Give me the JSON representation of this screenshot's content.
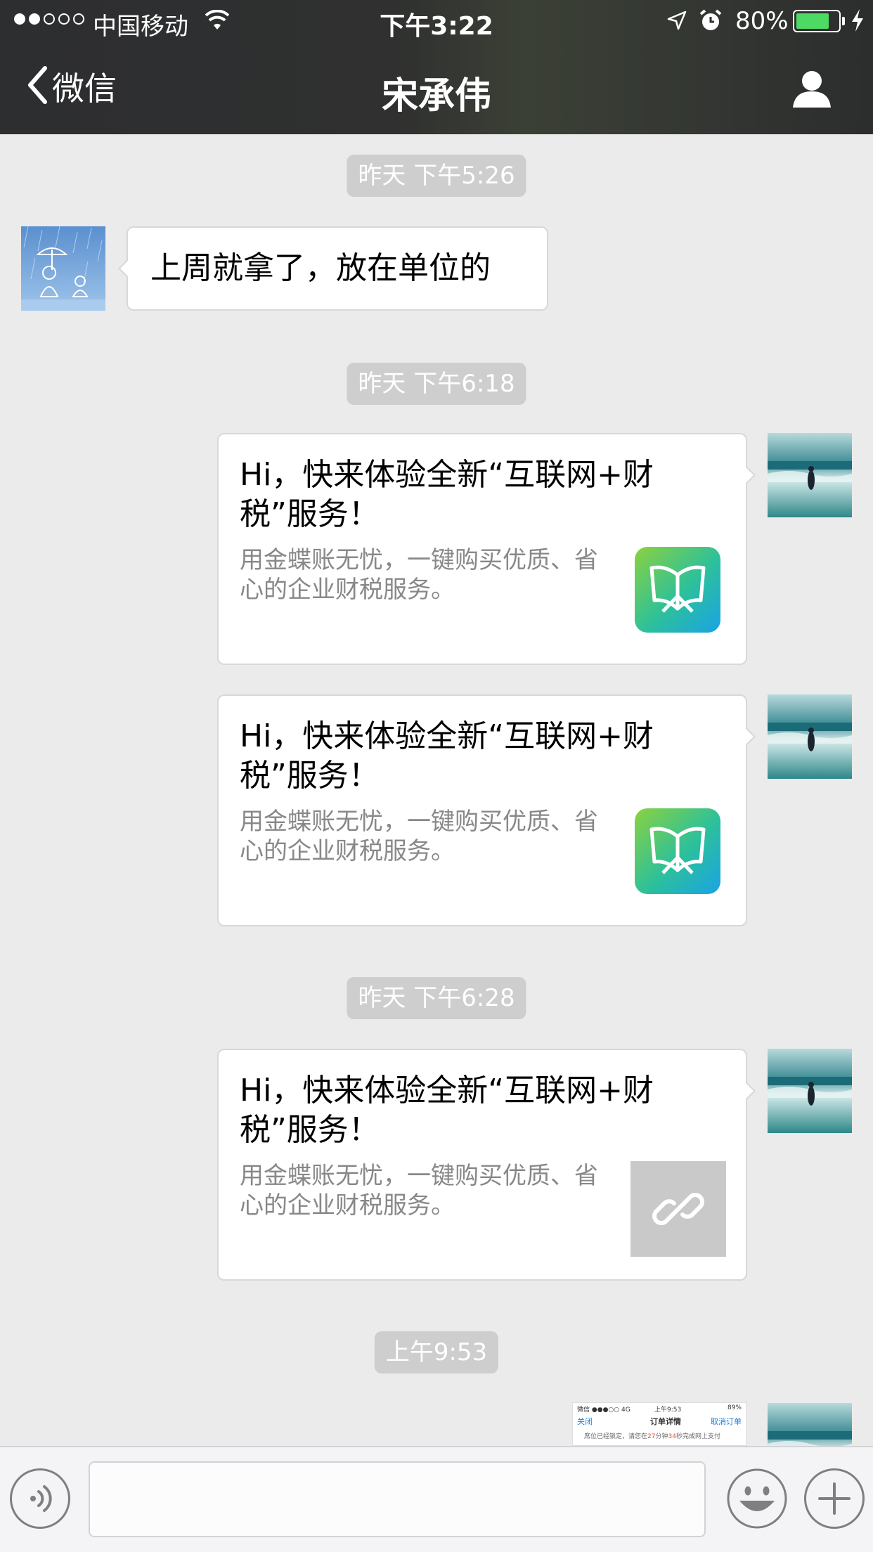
{
  "status_bar": {
    "carrier": "中国移动",
    "time": "下午3:22",
    "battery_percent": "80%",
    "battery_level": 0.8,
    "signal_bars": 2,
    "icons": [
      "signal-dots-icon",
      "wifi-icon",
      "location-arrow-icon",
      "alarm-clock-icon",
      "battery-icon",
      "charging-bolt-icon"
    ]
  },
  "nav": {
    "back_label": "微信",
    "title": "宋承伟",
    "icons": [
      "chevron-left-icon",
      "profile-person-icon"
    ]
  },
  "messages": [
    {
      "type": "timestamp",
      "text": "昨天 下午5:26"
    },
    {
      "type": "text",
      "side": "left",
      "text": "上周就拿了，放在单位的"
    },
    {
      "type": "timestamp",
      "text": "昨天 下午6:18"
    },
    {
      "type": "card",
      "side": "right",
      "title": "Hi，快来体验全新“互联网+财税”服务！",
      "desc": "用金蝶账无忧，一键购买优质、省心的企业财税服务。",
      "thumb": "butterfly-app-icon"
    },
    {
      "type": "card",
      "side": "right",
      "title": "Hi，快来体验全新“互联网+财税”服务！",
      "desc": "用金蝶账无忧，一键购买优质、省心的企业财税服务。",
      "thumb": "butterfly-app-icon"
    },
    {
      "type": "timestamp",
      "text": "昨天 下午6:28"
    },
    {
      "type": "card",
      "side": "right",
      "title": "Hi，快来体验全新“互联网+财税”服务！",
      "desc": "用金蝶账无忧，一键购买优质、省心的企业财税服务。",
      "thumb": "link-icon"
    },
    {
      "type": "timestamp",
      "text": "上午9:53"
    },
    {
      "type": "image",
      "side": "right",
      "screenshot": {
        "status_left": "微信 ●●●○○ 4G",
        "status_time": "上午9:53",
        "status_right": "89%",
        "nav_close": "关闭",
        "nav_title": "订单详情",
        "nav_cancel": "取消订单",
        "notice_prefix": "席位已经锁定，请您在",
        "notice_min": "27",
        "notice_mid": "分钟",
        "notice_sec": "34",
        "notice_suffix": "秒完成网上支付"
      }
    }
  ],
  "input_bar": {
    "placeholder": "",
    "icons": [
      "voice-icon",
      "emoji-icon",
      "plus-icon"
    ]
  },
  "colors": {
    "nav_bg": "#2e2f30",
    "chat_bg": "#ebebeb",
    "timestamp_bg": "#cecece",
    "battery_fill": "#4cd964",
    "card_desc": "#888888"
  }
}
